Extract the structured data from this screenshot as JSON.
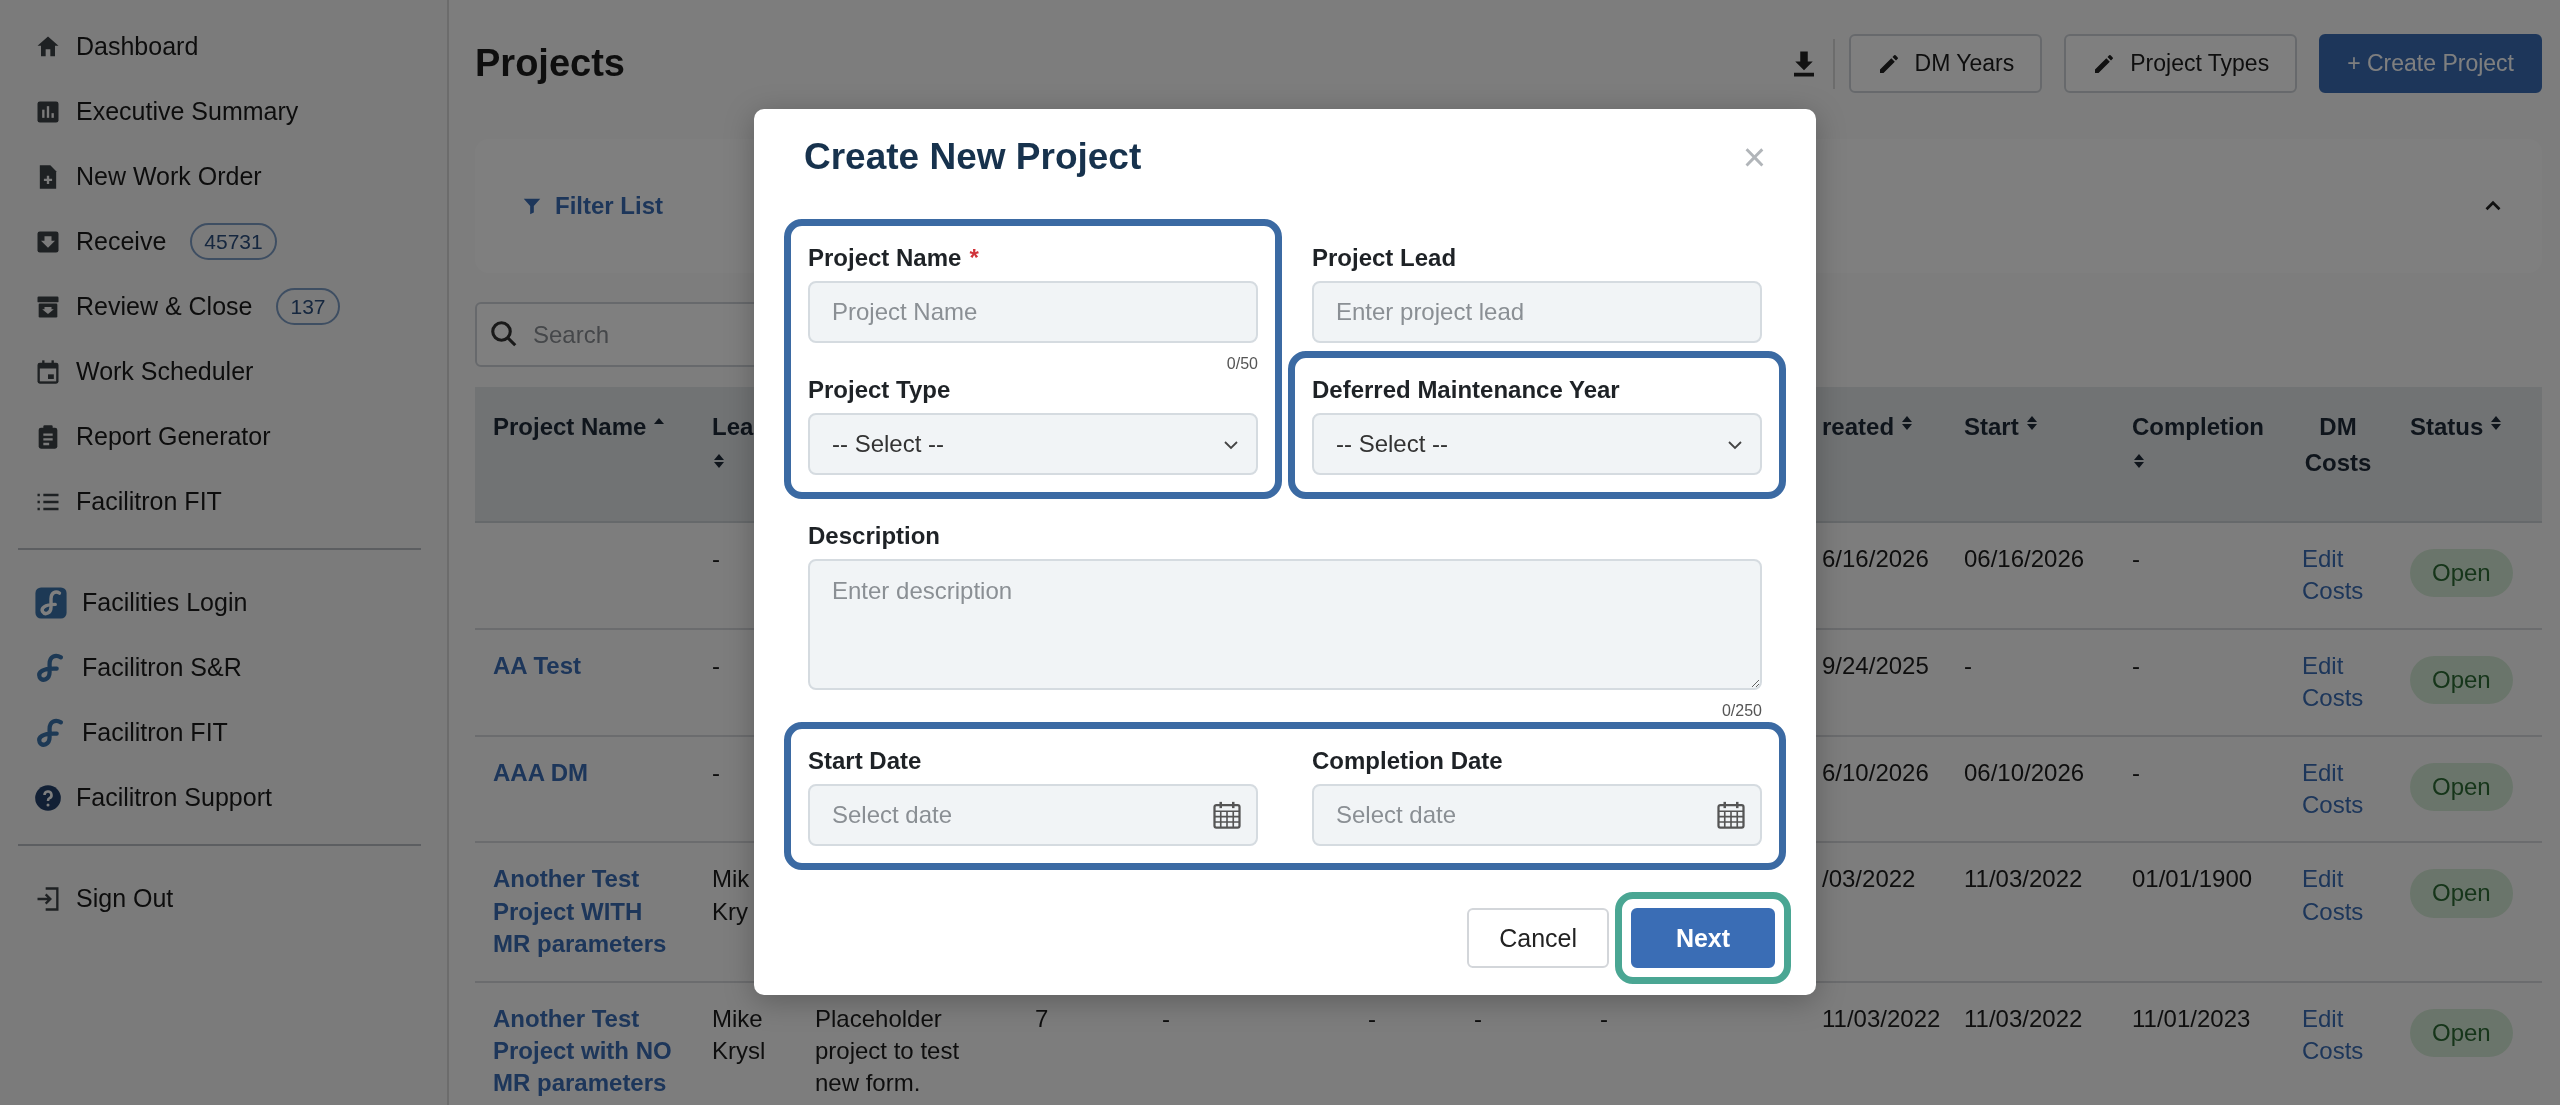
{
  "sidebar": {
    "groups": [
      {
        "items": [
          {
            "label": "Dashboard"
          },
          {
            "label": "Executive Summary"
          },
          {
            "label": "New Work Order"
          },
          {
            "label": "Receive",
            "badge": "45731"
          },
          {
            "label": "Review & Close",
            "badge": "137"
          },
          {
            "label": "Work Scheduler"
          },
          {
            "label": "Report Generator"
          },
          {
            "label": "Facilitron FIT"
          }
        ]
      },
      {
        "items": [
          {
            "label": "Facilities Login"
          },
          {
            "label": "Facilitron S&R"
          },
          {
            "label": "Facilitron FIT"
          },
          {
            "label": "Facilitron Support"
          }
        ]
      },
      {
        "items": [
          {
            "label": "Sign Out"
          }
        ]
      }
    ]
  },
  "page": {
    "title": "Projects",
    "buttons": [
      {
        "label": "DM Years",
        "kind": "outline"
      },
      {
        "label": "Project Types",
        "kind": "outline"
      },
      {
        "label": "+ Create Project",
        "kind": "primary"
      }
    ]
  },
  "filter": {
    "label": "Filter List",
    "expanded": true
  },
  "search": {
    "placeholder": "Search"
  },
  "table": {
    "columns": [
      {
        "label": "Project Name",
        "sortable": true,
        "sorted": true
      },
      {
        "label": "Lea",
        "sortable": true,
        "sorted": false
      },
      {
        "label": "reated",
        "sortable": true,
        "sorted": false
      },
      {
        "label": "Start",
        "sortable": true,
        "sorted": false
      },
      {
        "label": "Completion",
        "sortable": true,
        "sorted": false
      },
      {
        "label": "DM Costs",
        "sortable": false
      },
      {
        "label": "Status",
        "sortable": true,
        "sorted": false
      }
    ],
    "rows": [
      {
        "lead": "-",
        "created": "6/16/2026",
        "start": "06/16/2026",
        "completion": "-",
        "dm_costs": "Edit Costs",
        "status": "Open"
      },
      {
        "project_name": "AA Test",
        "lead": "-",
        "created": "9/24/2025",
        "start": "-",
        "completion": "-",
        "dm_costs": "Edit Costs",
        "status": "Open"
      },
      {
        "project_name": "AAA DM",
        "lead": "-",
        "created": "6/10/2026",
        "start": "06/10/2026",
        "completion": "-",
        "dm_costs": "Edit Costs",
        "status": "Open"
      },
      {
        "project_name": "Another Test Project WITH MR parameters",
        "lead": "Mik\nKry",
        "created": "/03/2022",
        "start": "11/03/2022",
        "completion": "01/01/1900",
        "dm_costs": "Edit Costs",
        "status": "Open"
      },
      {
        "project_name": "Another Test Project with NO MR parameters",
        "lead": "Mike Krysl",
        "description": "Placeholder project to test new form.",
        "column_4": "7",
        "column_5": "-",
        "column_6": "-",
        "column_7": "-",
        "column_8": "-",
        "created": "11/03/2022",
        "start": "11/03/2022",
        "completion": "11/01/2023",
        "dm_costs": "Edit Costs",
        "status": "Open"
      }
    ]
  },
  "modal": {
    "title": "Create New Project",
    "close": "×",
    "sections": [
      {
        "kind": "columns",
        "columns": [
          [
            {
              "highlighted": true,
              "color": "#3b6aa3",
              "fields": [
                {
                  "kind": "text",
                  "label": "Project Name",
                  "required_mark": "*",
                  "placeholder": "Project Name",
                  "counter": "0/50"
                },
                {
                  "kind": "select",
                  "label": "Project Type",
                  "value": "-- Select --"
                }
              ]
            }
          ],
          [
            {
              "highlighted": false,
              "fields": [
                {
                  "kind": "text",
                  "label": "Project Lead",
                  "placeholder": "Enter project lead"
                }
              ]
            },
            {
              "highlighted": true,
              "color": "#3b6aa3",
              "fields": [
                {
                  "kind": "select",
                  "label": "Deferred Maintenance Year",
                  "value": "-- Select --"
                }
              ]
            }
          ]
        ]
      },
      {
        "kind": "full",
        "groups": [
          {
            "highlighted": false,
            "fields": [
              {
                "kind": "textarea",
                "label": "Description",
                "placeholder": "Enter description",
                "counter": "0/250"
              }
            ]
          }
        ]
      },
      {
        "kind": "pair",
        "groups": [
          {
            "highlighted": true,
            "color": "#3b6aa3",
            "fields": [
              {
                "kind": "date",
                "label": "Start Date",
                "placeholder": "Select date"
              },
              {
                "kind": "date",
                "label": "Completion Date",
                "placeholder": "Select date"
              }
            ]
          }
        ]
      }
    ],
    "buttons": [
      {
        "label": "Cancel",
        "kind": "secondary",
        "highlighted": false
      },
      {
        "label": "Next",
        "kind": "primary",
        "highlighted": true,
        "color": "#4aa693"
      }
    ]
  }
}
